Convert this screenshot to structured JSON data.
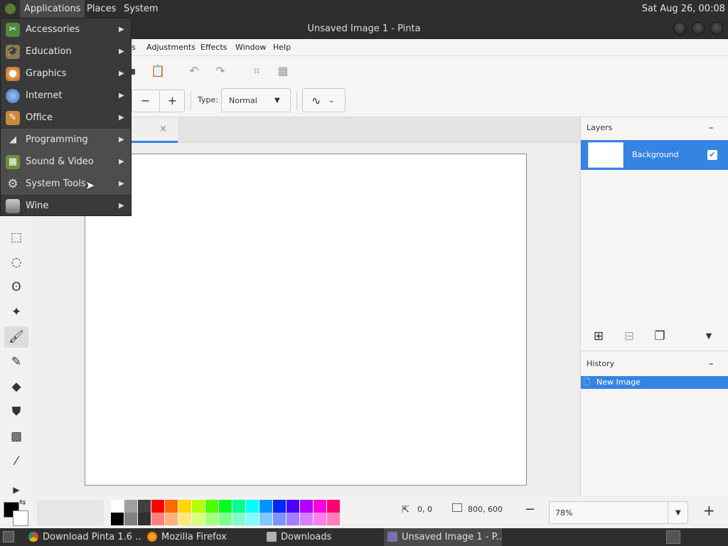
{
  "top_panel": {
    "applications": "Applications",
    "places": "Places",
    "system": "System",
    "clock": "Sat Aug 26, 00:08"
  },
  "window": {
    "title": "Unsaved Image 1 - Pinta"
  },
  "menubar": {
    "items": [
      "s",
      "Adjustments",
      "Effects",
      "Window",
      "Help"
    ]
  },
  "toolbar2": {
    "minus": "−",
    "plus": "+",
    "type_label": "Type:",
    "type_value": "Normal"
  },
  "tab": {
    "close": "×"
  },
  "layers": {
    "header": "Layers",
    "collapse": "–",
    "items": [
      {
        "name": "Background",
        "visible": true
      }
    ]
  },
  "history": {
    "header": "History",
    "collapse": "–",
    "items": [
      "New Image"
    ]
  },
  "status": {
    "cursor_pos": "0, 0",
    "selection_size": "800, 600",
    "zoom": "78%",
    "zoom_out": "−",
    "zoom_in": "+"
  },
  "palette": {
    "colors_top": [
      "#ffffff",
      "#a0a0a0",
      "#404040",
      "#ff0000",
      "#ff6a00",
      "#ffd800",
      "#b6ff00",
      "#4cff00",
      "#00ff21",
      "#00ff90",
      "#00ffff",
      "#0094ff",
      "#0026ff",
      "#4800ff",
      "#b200ff",
      "#ff00dc",
      "#ff006e"
    ],
    "colors_bottom": [
      "#000000",
      "#808080",
      "#303030",
      "#ff7f7f",
      "#ffb27f",
      "#ffe97f",
      "#daff7f",
      "#a5ff7f",
      "#7fff8e",
      "#7fffc5",
      "#7fffff",
      "#7fc9ff",
      "#7f92ff",
      "#a17fff",
      "#d67fff",
      "#ff7fed",
      "#ff7fb6"
    ],
    "primary": "#000000",
    "secondary": "#ffffff"
  },
  "taskbar": {
    "tasks": [
      "Download Pinta 1.6 ...",
      "Mozilla Firefox",
      "Downloads",
      "Unsaved Image 1 - P..."
    ]
  },
  "app_menu": {
    "items": [
      {
        "label": "Accessories",
        "icon": "accessories-icon"
      },
      {
        "label": "Education",
        "icon": "education-icon"
      },
      {
        "label": "Graphics",
        "icon": "graphics-icon"
      },
      {
        "label": "Internet",
        "icon": "internet-icon"
      },
      {
        "label": "Office",
        "icon": "office-icon"
      },
      {
        "label": "Programming",
        "icon": "programming-icon"
      },
      {
        "label": "Sound & Video",
        "icon": "sound-video-icon"
      },
      {
        "label": "System Tools",
        "icon": "system-tools-icon"
      },
      {
        "label": "Wine",
        "icon": "wine-icon"
      }
    ]
  }
}
